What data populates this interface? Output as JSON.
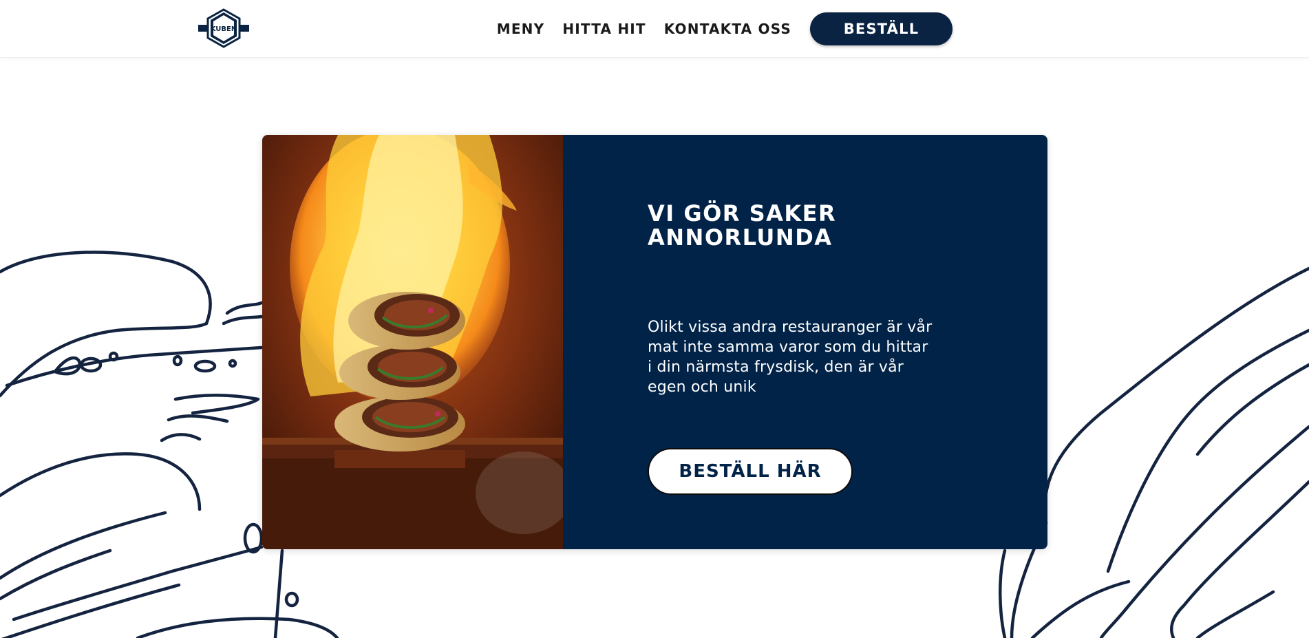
{
  "header": {
    "logo_text": "KUBEN",
    "nav": [
      {
        "label": "MENY"
      },
      {
        "label": "HITTA HIT"
      },
      {
        "label": "KONTAKTA OSS"
      }
    ],
    "order_label": "BESTÄLL"
  },
  "hero": {
    "title_line1": "VI GÖR SAKER",
    "title_line2": "ANNORLUNDA",
    "text": "Olikt vissa andra restauranger är vår mat inte samma varor som du hittar i din närmsta frysdisk, den är vår egen och unik",
    "button_label": "BESTÄLL HÄR"
  },
  "colors": {
    "brand_navy": "#022348",
    "nav_text": "#1a1a1a",
    "line_art": "#142440"
  },
  "icons": {
    "logo": "kuben-hexagon-logo"
  }
}
